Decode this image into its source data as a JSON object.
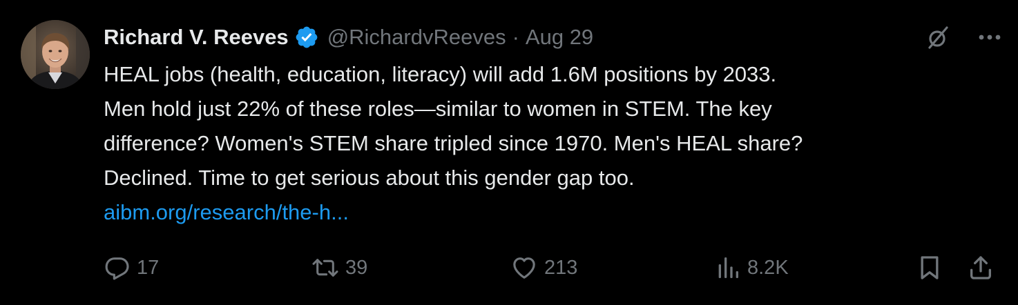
{
  "tweet": {
    "author": {
      "display_name": "Richard V. Reeves",
      "verified": true,
      "handle": "@RichardvReeves",
      "separator": "·",
      "date": "Aug 29",
      "avatar_icon": "profile-photo"
    },
    "text_lines": [
      "HEAL jobs (health, education, literacy) will add 1.6M positions by 2033.",
      "Men hold just 22% of these roles—similar to women in STEM. The key",
      "difference? Women's STEM share tripled since 1970. Men's HEAL share?",
      "Declined. Time to get serious about this gender gap too."
    ],
    "link_text": "aibm.org/research/the-h...",
    "top_actions": {
      "grok_icon": "grok-icon",
      "more_icon": "more-icon"
    },
    "stats": {
      "replies": "17",
      "reposts": "39",
      "likes": "213",
      "views": "8.2K"
    },
    "colors": {
      "background": "#000000",
      "text": "#e7e9ea",
      "muted": "#71767b",
      "link": "#1d9bf0",
      "verified": "#1d9bf0"
    }
  }
}
